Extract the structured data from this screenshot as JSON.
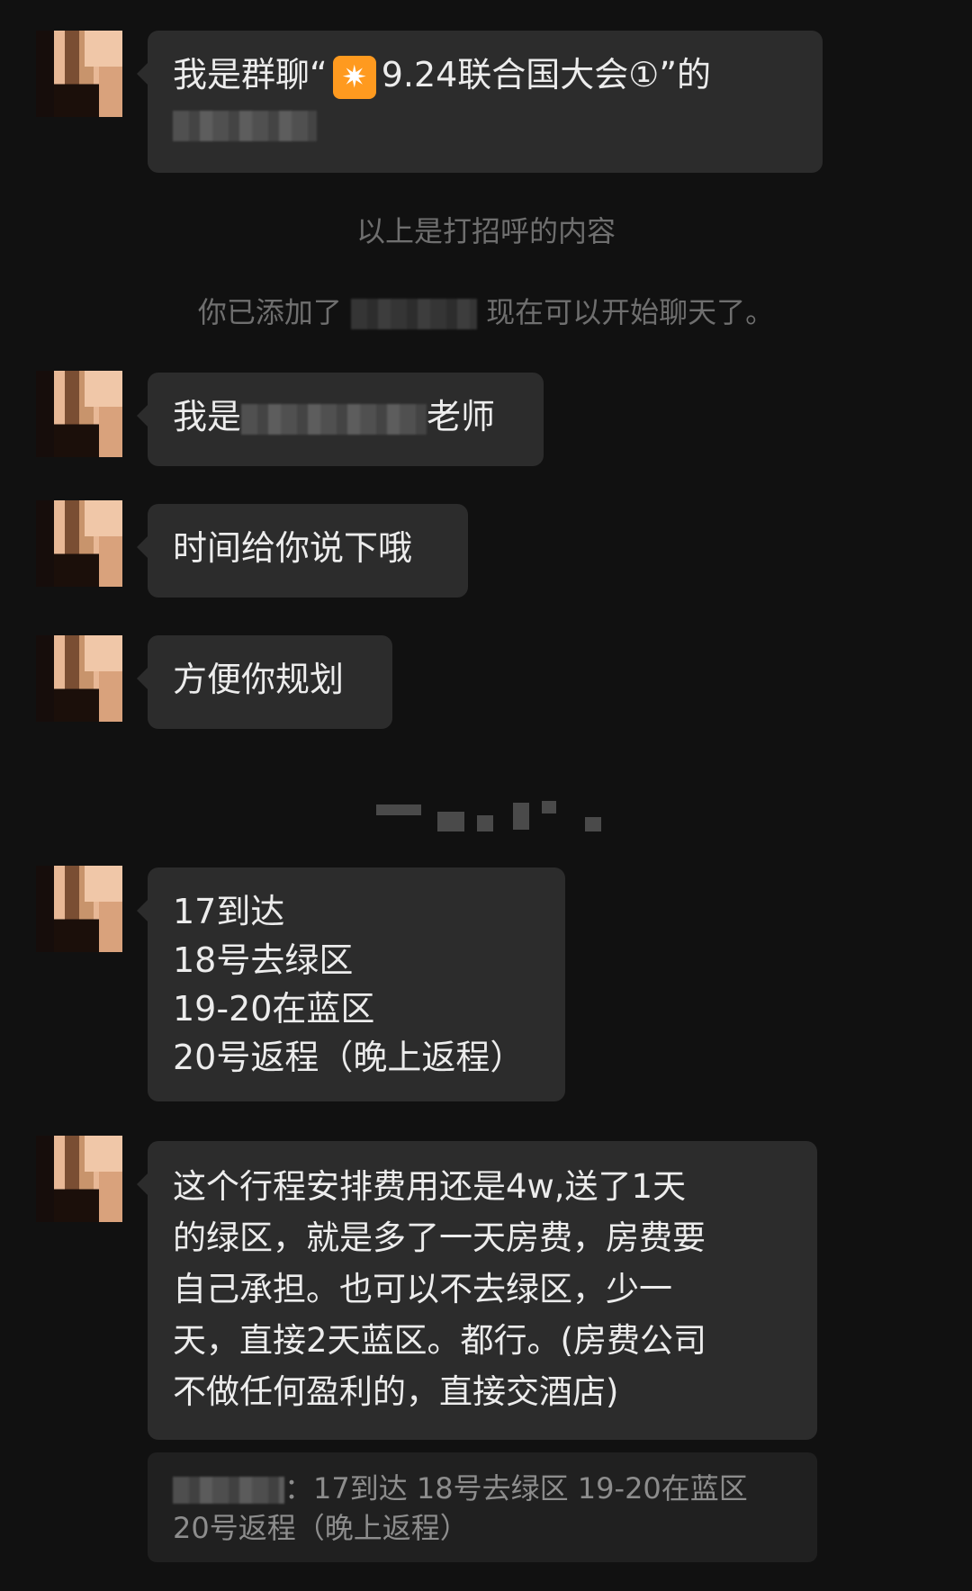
{
  "messages": {
    "m1": {
      "prefix": "我是群聊“",
      "emoji": "✷",
      "group": "9.24联合国大会①",
      "suffix": "”的"
    },
    "sys1": "以上是打招呼的内容",
    "sys2": {
      "prefix": "你已添加了",
      "suffix": "现在可以开始聊天了。"
    },
    "m2": {
      "prefix": "我是",
      "suffix": "老师"
    },
    "m3": "时间给你说下哦",
    "m4": "方便你规划",
    "m5": [
      "17到达",
      "18号去绿区",
      "19-20在蓝区",
      "20号返程（晚上返程）"
    ],
    "m6": [
      "这个行程安排费用还是4w,送了1天",
      "的绿区，就是多了一天房费，房费要",
      "自己承担。也可以不去绿区，少一",
      "天，直接2天蓝区。都行。(房费公司",
      "不做任何盈利的，直接交酒店)"
    ],
    "quote": {
      "separator": "：",
      "line1": "17到达 18号去绿区 19-20在蓝区",
      "line2": "20号返程（晚上返程）"
    }
  }
}
